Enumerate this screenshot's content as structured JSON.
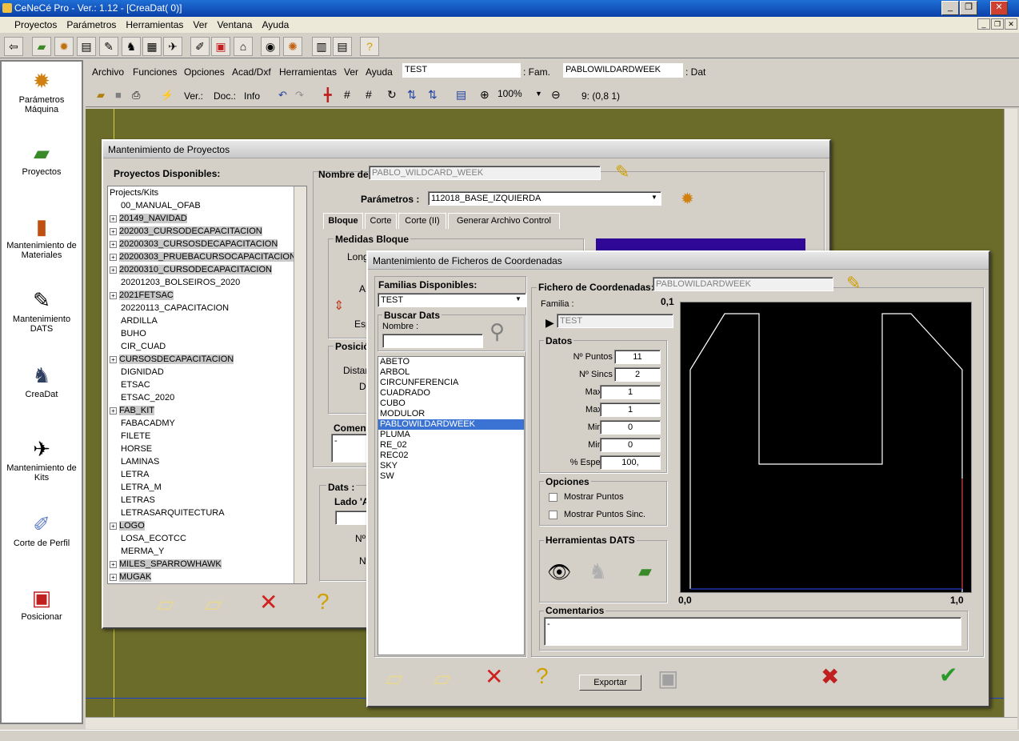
{
  "app": {
    "title": "CeNeCé Pro - Ver.: 1.12 - [CreaDat( 0)]"
  },
  "menu": [
    "Proyectos",
    "Parámetros",
    "Herramientas",
    "Ver",
    "Ventana",
    "Ayuda"
  ],
  "left_panel": [
    "Parámetros\nMáquina",
    "Proyectos",
    "Mantenimiento de\nMateriales",
    "Mantenimiento\nDATS",
    "CreaDat",
    "Mantenimiento de\nKits",
    "Corte de Perfil",
    "Posicionar"
  ],
  "sub_menu": [
    "Archivo",
    "Funciones",
    "Opciones",
    "Acad/Dxf",
    "Herramientas",
    "Ver",
    "Ayuda"
  ],
  "sub_fam_value": "TEST",
  "sub_fam_label": ": Fam.",
  "sub_dat_value": "PABLOWILDARDWEEK",
  "sub_dat_label": ": Dat",
  "sub2": {
    "ver": "Ver.:",
    "doc": "Doc.:",
    "info": "Info",
    "zoom": "100%",
    "coord": "9: (0,8 1)"
  },
  "proj": {
    "title": "Mantenimiento de Proyectos",
    "available": "Proyectos Disponibles:",
    "root": "Projects/Kits",
    "items": [
      {
        "t": "00_MANUAL_OFAB",
        "p": false,
        "h": false
      },
      {
        "t": "20149_NAVIDAD",
        "p": true,
        "h": true
      },
      {
        "t": "202003_CURSODECAPACITACION",
        "p": true,
        "h": true
      },
      {
        "t": "20200303_CURSOSDECAPACITACION",
        "p": true,
        "h": true
      },
      {
        "t": "20200303_PRUEBACURSOCAPACITACION",
        "p": true,
        "h": true
      },
      {
        "t": "20200310_CURSODECAPACITACION",
        "p": true,
        "h": true
      },
      {
        "t": "20201203_BOLSEIROS_2020",
        "p": false,
        "h": false
      },
      {
        "t": "2021FETSAC",
        "p": true,
        "h": true
      },
      {
        "t": "20220113_CAPACITACION",
        "p": false,
        "h": false
      },
      {
        "t": "ARDILLA",
        "p": false,
        "h": false
      },
      {
        "t": "BUHO",
        "p": false,
        "h": false
      },
      {
        "t": "CIR_CUAD",
        "p": false,
        "h": false
      },
      {
        "t": "CURSOSDECAPACITACION",
        "p": true,
        "h": true
      },
      {
        "t": "DIGNIDAD",
        "p": false,
        "h": false
      },
      {
        "t": "ETSAC",
        "p": false,
        "h": false
      },
      {
        "t": "ETSAC_2020",
        "p": false,
        "h": false
      },
      {
        "t": "FAB_KIT",
        "p": true,
        "h": true
      },
      {
        "t": "FABACADMY",
        "p": false,
        "h": false
      },
      {
        "t": "FILETE",
        "p": false,
        "h": false
      },
      {
        "t": "HORSE",
        "p": false,
        "h": false
      },
      {
        "t": "LAMINAS",
        "p": false,
        "h": false
      },
      {
        "t": "LETRA",
        "p": false,
        "h": false
      },
      {
        "t": "LETRA_M",
        "p": false,
        "h": false
      },
      {
        "t": "LETRAS",
        "p": false,
        "h": false
      },
      {
        "t": "LETRASARQUITECTURA",
        "p": false,
        "h": false
      },
      {
        "t": "LOGO",
        "p": true,
        "h": true
      },
      {
        "t": "LOSA_ECOTCC",
        "p": false,
        "h": false
      },
      {
        "t": "MERMA_Y",
        "p": false,
        "h": false
      },
      {
        "t": "MILES_SPARROWHAWK",
        "p": true,
        "h": true
      },
      {
        "t": "MUGAK",
        "p": true,
        "h": true
      }
    ],
    "nombre_label": "Nombre de",
    "nombre_value": "PABLO_WILDCARD_WEEK",
    "param_label": "Parámetros :",
    "param_value": "112018_BASE_IZQUIERDA",
    "tabs": [
      "Bloque",
      "Corte",
      "Corte (II)",
      "Generar Archivo Control"
    ],
    "medidas": "Medidas Bloque",
    "long": "Longi",
    "a": "A",
    "esp": "Esp",
    "posic": "Posició",
    "distan": "Distan",
    "d": "D",
    "coment": "Coment",
    "coment_value": "-",
    "dats": "Dats :",
    "lado": "Lado 'A",
    "n1": "Nº",
    "n2": "Nº"
  },
  "coord": {
    "title": "Mantenimiento de Ficheros de Coordenadas",
    "familias": "Familias Disponibles:",
    "familia_value": "TEST",
    "buscar": "Buscar Dats",
    "nombre": "Nombre :",
    "dats": [
      "ABETO",
      "ARBOL",
      "CIRCUNFERENCIA",
      "CUADRADO",
      "CUBO",
      "MODULOR",
      "PABLOWILDARDWEEK",
      "PLUMA",
      "RE_02",
      "REC02",
      "SKY",
      "SW"
    ],
    "selected": "PABLOWILDARDWEEK",
    "fichero_label": "Fichero de Coordenadas:",
    "fichero_value": "PABLOWILDARDWEEK",
    "familia_label": "Familia :",
    "familia_field": "TEST",
    "datos": "Datos",
    "rows": [
      {
        "l": "Nº Puntos :",
        "v": "11"
      },
      {
        "l": "Nº Sincs :",
        "v": "2"
      },
      {
        "l": "Max. X :",
        "v": "1"
      },
      {
        "l": "Max. Y :",
        "v": "1"
      },
      {
        "l": "Min. X :",
        "v": "0"
      },
      {
        "l": "Min. Y :",
        "v": "0"
      },
      {
        "l": "% Espesor :",
        "v": "100,"
      }
    ],
    "opciones": "Opciones",
    "mostrar_puntos": "Mostrar Puntos",
    "mostrar_sinc": "Mostrar Puntos Sinc.",
    "herramientas": "Herramientas DATS",
    "corner_tl": "0,1",
    "corner_bl": "0,0",
    "corner_br": "1,0",
    "comentarios": "Comentarios",
    "coment_value": "-",
    "exportar": "Exportar"
  }
}
